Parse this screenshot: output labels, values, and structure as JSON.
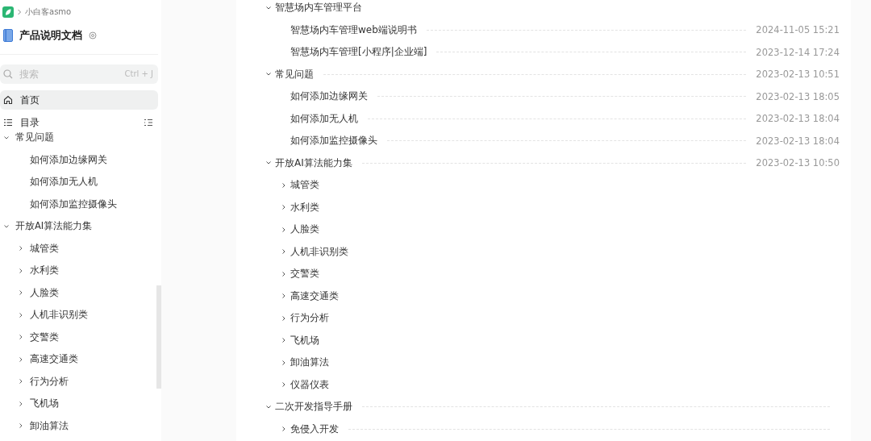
{
  "sidebar": {
    "breadcrumb": "小白客asmo",
    "title": "产品说明文档",
    "search": {
      "placeholder": "搜索",
      "shortcut": "Ctrl + J"
    },
    "nav": [
      {
        "label": "首页",
        "selected": true
      },
      {
        "label": "目录",
        "selected": false
      }
    ],
    "tree": [
      {
        "title": "常见问题",
        "expanded": true,
        "children": [
          {
            "title": "如何添加边缘网关"
          },
          {
            "title": "如何添加无人机"
          },
          {
            "title": "如何添加监控摄像头"
          }
        ]
      },
      {
        "title": "开放AI算法能力集",
        "expanded": true,
        "children": [
          {
            "title": "城管类",
            "expanded": false
          },
          {
            "title": "水利类",
            "expanded": false
          },
          {
            "title": "人脸类",
            "expanded": false
          },
          {
            "title": "人机非识别类",
            "expanded": false
          },
          {
            "title": "交警类",
            "expanded": false
          },
          {
            "title": "高速交通类",
            "expanded": false
          },
          {
            "title": "行为分析",
            "expanded": false
          },
          {
            "title": "飞机场",
            "expanded": false
          },
          {
            "title": "卸油算法",
            "expanded": false
          }
        ]
      }
    ]
  },
  "main": {
    "tree": [
      {
        "title": "智慧场内车管理平台",
        "expanded": true,
        "leader": false,
        "children": [
          {
            "title": "智慧场内车管理web端说明书",
            "leader": true,
            "date": "2024-11-05 15:21"
          },
          {
            "title": "智慧场内车管理[小程序|企业端]",
            "leader": true,
            "date": "2023-12-14 17:24"
          }
        ]
      },
      {
        "title": "常见问题",
        "expanded": true,
        "leader": true,
        "date": "2023-02-13 10:51",
        "children": [
          {
            "title": "如何添加边缘网关",
            "leader": true,
            "date": "2023-02-13 18:05"
          },
          {
            "title": "如何添加无人机",
            "leader": true,
            "date": "2023-02-13 18:04"
          },
          {
            "title": "如何添加监控摄像头",
            "leader": true,
            "date": "2023-02-13 18:04"
          }
        ]
      },
      {
        "title": "开放AI算法能力集",
        "expanded": true,
        "leader": true,
        "date": "2023-02-13 10:50",
        "children": [
          {
            "title": "城管类",
            "expanded": false,
            "leader": false
          },
          {
            "title": "水利类",
            "expanded": false,
            "leader": false
          },
          {
            "title": "人脸类",
            "expanded": false,
            "leader": false
          },
          {
            "title": "人机非识别类",
            "expanded": false,
            "leader": false
          },
          {
            "title": "交警类",
            "expanded": false,
            "leader": false
          },
          {
            "title": "高速交通类",
            "expanded": false,
            "leader": false
          },
          {
            "title": "行为分析",
            "expanded": false,
            "leader": false
          },
          {
            "title": "飞机场",
            "expanded": false,
            "leader": false
          },
          {
            "title": "卸油算法",
            "expanded": false,
            "leader": false
          },
          {
            "title": "仪器仪表",
            "expanded": false,
            "leader": false
          }
        ]
      },
      {
        "title": "二次开发指导手册",
        "expanded": true,
        "leader": true,
        "children": [
          {
            "title": "免侵入开发",
            "expanded": false,
            "leader": true
          }
        ]
      }
    ]
  }
}
